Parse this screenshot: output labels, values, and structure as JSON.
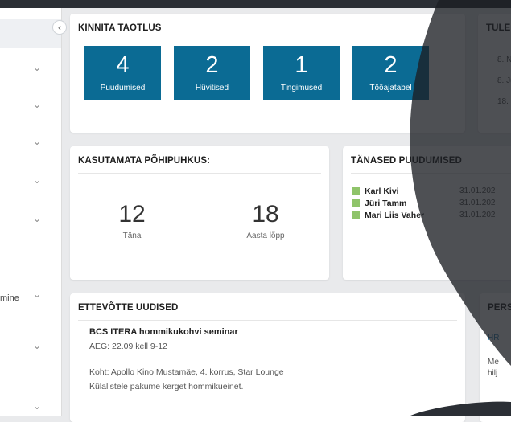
{
  "sidebar": {
    "items": [
      {
        "label": ""
      },
      {
        "label": ""
      },
      {
        "label": ""
      },
      {
        "label": ""
      },
      {
        "label": ""
      },
      {
        "label": "mine"
      },
      {
        "label": ""
      },
      {
        "label": ""
      }
    ],
    "collapse_glyph": "‹"
  },
  "confirm_card": {
    "title": "KINNITA TAOTLUS",
    "tiles": [
      {
        "count": "4",
        "label": "Puudumised"
      },
      {
        "count": "2",
        "label": "Hüvitised"
      },
      {
        "count": "1",
        "label": "Tingimused"
      },
      {
        "count": "2",
        "label": "Tööajatabel"
      }
    ]
  },
  "upcoming_card": {
    "title": "TULE",
    "lines": [
      "8. N",
      "8. Ju",
      "18."
    ]
  },
  "vacation_card": {
    "title": "KASUTAMATA PÕHIPUHKUS:",
    "stats": [
      {
        "value": "12",
        "label": "Täna"
      },
      {
        "value": "18",
        "label": "Aasta lõpp"
      }
    ]
  },
  "absences_card": {
    "title": "TÄNASED PUUDUMISED",
    "rows": [
      {
        "name": "Karl Kivi",
        "date": "31.01.202"
      },
      {
        "name": "Jüri Tamm",
        "date": "31.01.202"
      },
      {
        "name": "Mari Liis Vaher",
        "date": "31.01.202"
      }
    ]
  },
  "news_card": {
    "title": "ETTEVÕTTE UUDISED",
    "item_title": "BCS ITERA hommikukohvi seminar",
    "lines": [
      "AEG: 22.09 kell 9-12",
      "Koht: Apollo Kino Mustamäe, 4. korrus, Star Lounge",
      "Külalistele pakume kerget hommikueinet."
    ]
  },
  "personal_card": {
    "title": "PERS",
    "link": "HR",
    "lines": [
      "Me",
      "hilj"
    ]
  },
  "colors": {
    "tile": "#0b6b94",
    "absence_marker": "#8fc46a",
    "background": "#e9eaec",
    "overlay": "#1c1f24"
  },
  "icons": {
    "sidebar_chevron": "chevron-down-icon",
    "collapse": "chevron-left-icon"
  }
}
